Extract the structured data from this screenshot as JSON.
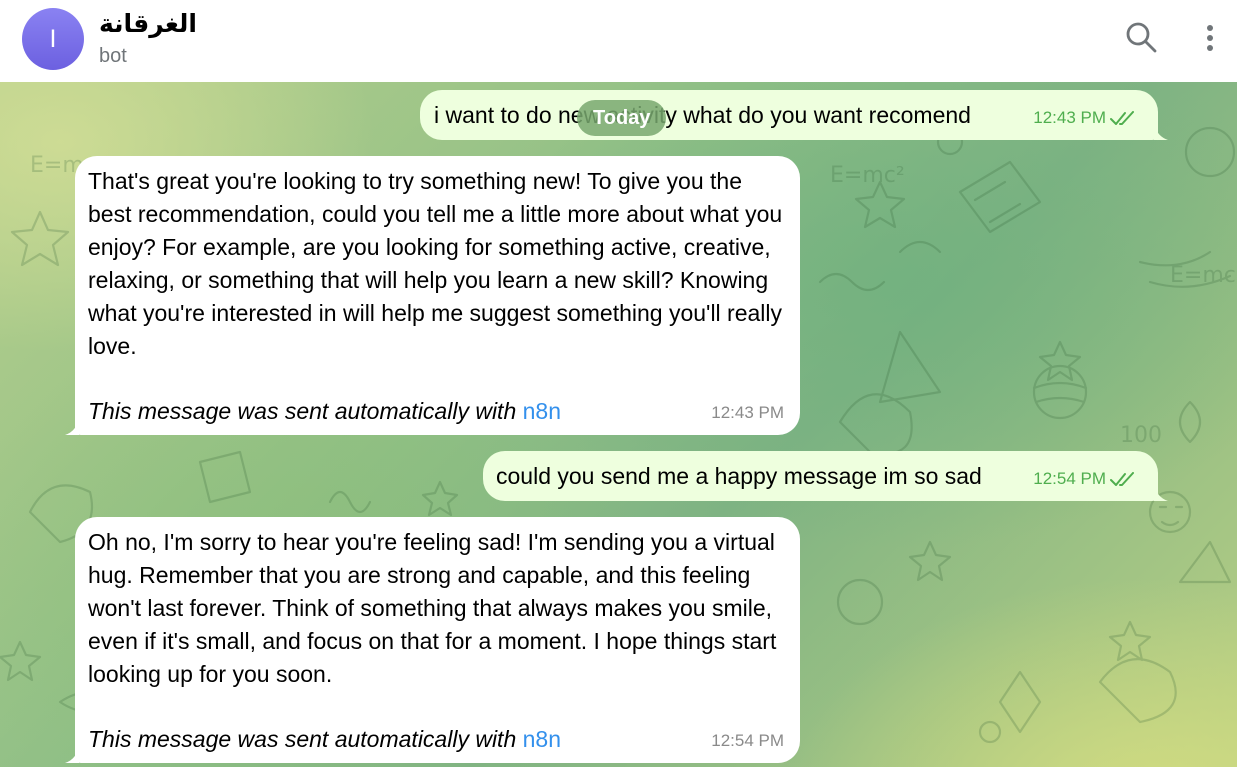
{
  "header": {
    "avatar_letter": "I",
    "title": "الغرقانة",
    "subtitle": "bot"
  },
  "date_separator": "Today",
  "messages": [
    {
      "direction": "outgoing",
      "text": "i want to do new activity what do you want recomend",
      "time": "12:43 PM",
      "status": "read"
    },
    {
      "direction": "incoming",
      "text": "That's great you're looking to try something new! To give you the best recommendation, could you tell me a little more about what you enjoy? For example, are you looking for something active, creative, relaxing, or something that will help you learn a new skill? Knowing what you're interested in will help me suggest something you'll really love.",
      "auto_note": "This message was sent automatically with ",
      "link": "n8n",
      "time": "12:43 PM"
    },
    {
      "direction": "outgoing",
      "text": "could you send me a happy message im so sad",
      "time": "12:54 PM",
      "status": "read"
    },
    {
      "direction": "incoming",
      "text": "Oh no, I'm sorry to hear you're feeling sad! I'm sending you a virtual hug. Remember that you are strong and capable, and this feeling won't last forever. Think of something that always makes you smile, even if it's small, and focus on that for a moment. I hope things start looking up for you soon.",
      "auto_note": "This message was sent automatically with ",
      "link": "n8n",
      "time": "12:54 PM"
    }
  ],
  "icons": {
    "search": "search-icon",
    "more": "more-vertical-icon",
    "read_status": "double-check-icon"
  },
  "colors": {
    "avatar": "#7b70ea",
    "outgoing_bubble": "#eeffde",
    "incoming_bubble": "#ffffff",
    "outgoing_time": "#4fae4e",
    "link": "#3390ec",
    "subtitle": "#707579"
  }
}
